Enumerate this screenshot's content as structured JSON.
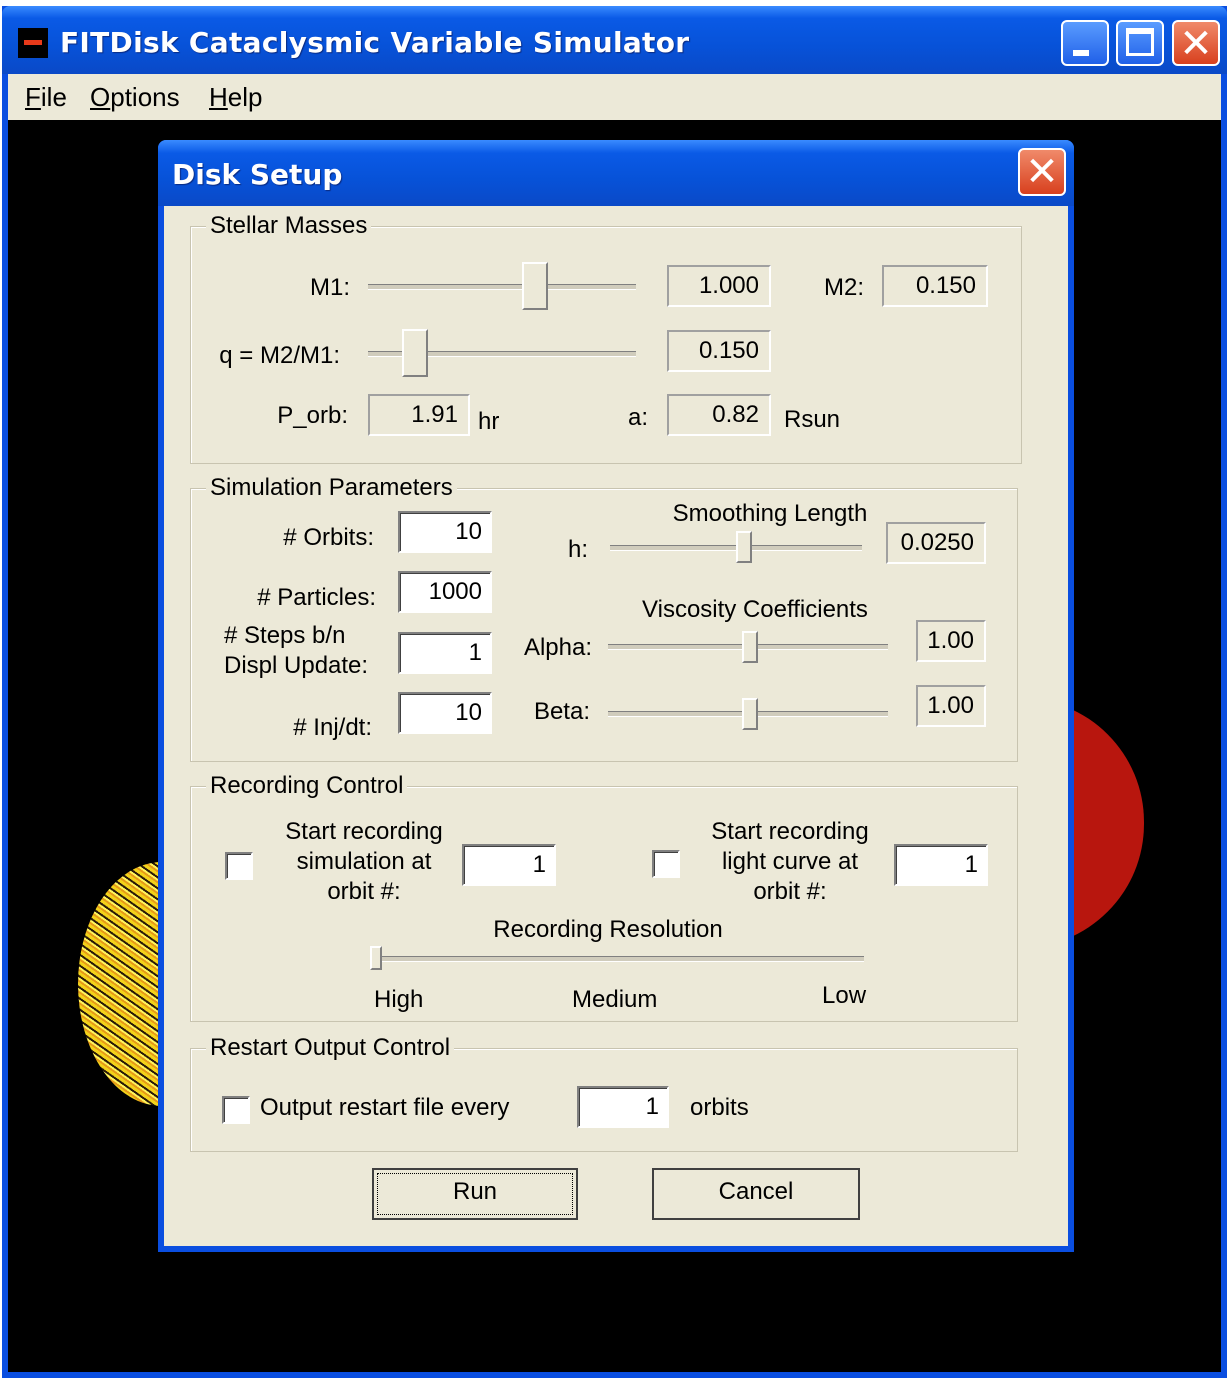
{
  "window": {
    "title": "FITDisk Cataclysmic Variable Simulator"
  },
  "menu": {
    "items": [
      {
        "mnemonic": "F",
        "rest": "ile"
      },
      {
        "mnemonic": "O",
        "rest": "ptions"
      },
      {
        "mnemonic": "H",
        "rest": "elp"
      }
    ]
  },
  "dialog": {
    "title": "Disk Setup",
    "stellar_masses": {
      "legend": "Stellar Masses",
      "m1_label": "M1:",
      "m1_value": "1.000",
      "m2_label": "M2:",
      "m2_value": "0.150",
      "q_label": "q = M2/M1:",
      "q_value": "0.150",
      "porb_label": "P_orb:",
      "porb_value": "1.91",
      "porb_unit": "hr",
      "a_label": "a:",
      "a_value": "0.82",
      "a_unit": "Rsun"
    },
    "simulation_parameters": {
      "legend": "Simulation Parameters",
      "orbits_label": "# Orbits:",
      "orbits_value": "10",
      "particles_label": "# Particles:",
      "particles_value": "1000",
      "steps_label_line1": "# Steps b/n",
      "steps_label_line2": "Displ Update:",
      "steps_value": "1",
      "inj_label": "# Inj/dt:",
      "inj_value": "10",
      "smoothing_heading": "Smoothing Length",
      "h_label": "h:",
      "h_value": "0.0250",
      "viscosity_heading": "Viscosity Coefficients",
      "alpha_label": "Alpha:",
      "alpha_value": "1.00",
      "beta_label": "Beta:",
      "beta_value": "1.00"
    },
    "recording_control": {
      "legend": "Recording Control",
      "sim_label_line1": "Start recording",
      "sim_label_line2": "simulation at",
      "sim_label_line3": "orbit #:",
      "sim_value": "1",
      "lc_label_line1": "Start recording",
      "lc_label_line2": "light curve at",
      "lc_label_line3": "orbit #:",
      "lc_value": "1",
      "resolution_heading": "Recording Resolution",
      "res_high": "High",
      "res_medium": "Medium",
      "res_low": "Low"
    },
    "restart_output_control": {
      "legend": "Restart Output Control",
      "checkbox_label": "Output restart file every",
      "value": "1",
      "unit": "orbits"
    },
    "buttons": {
      "run": "Run",
      "cancel": "Cancel"
    }
  },
  "colors": {
    "title_bar_blue": "#0752d8",
    "dialog_face": "#ece9d8",
    "accretion_disc_red": "#b8160e",
    "particles_yellow": "#f2d21a"
  },
  "icons": [
    "app-icon",
    "minimize-icon",
    "maximize-icon",
    "close-icon"
  ]
}
